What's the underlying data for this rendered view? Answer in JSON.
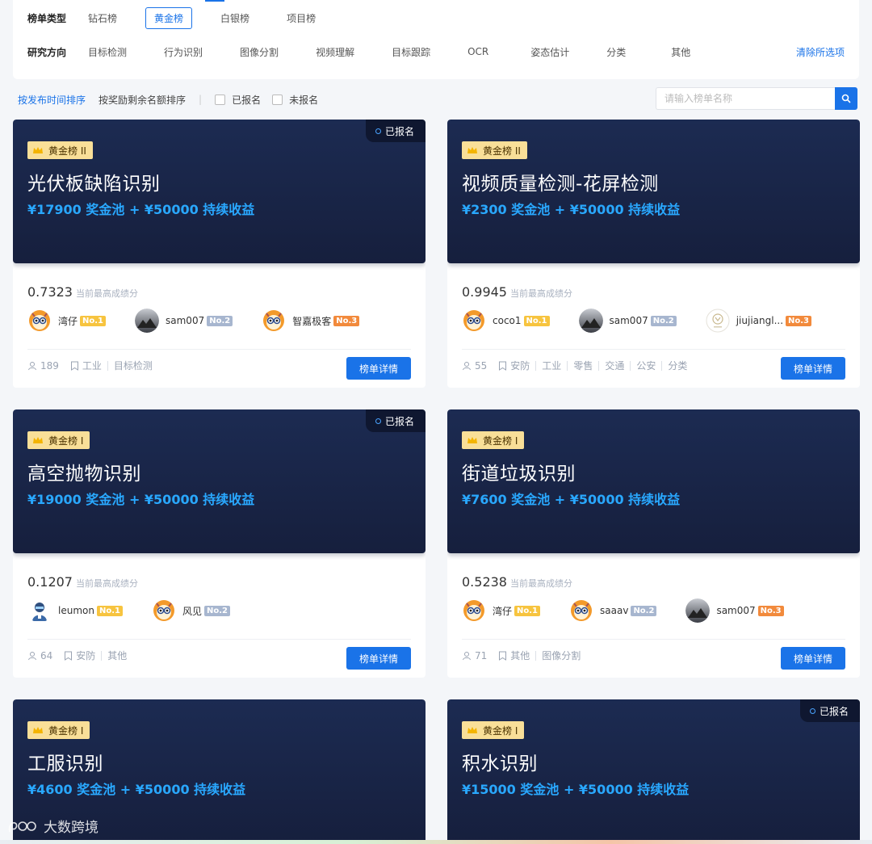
{
  "filters": {
    "type_label": "榜单类型",
    "types": [
      "钻石榜",
      "黄金榜",
      "白银榜",
      "项目榜"
    ],
    "active_type": "黄金榜",
    "direction_label": "研究方向",
    "directions": [
      "目标检测",
      "行为识别",
      "图像分割",
      "视频理解",
      "目标跟踪",
      "OCR",
      "姿态估计",
      "分类",
      "其他"
    ],
    "clear_label": "清除所选项"
  },
  "sort": {
    "by_time": "按发布时间排序",
    "by_remaining": "按奖励剩余名额排序",
    "separator": "|",
    "enrolled_label": "已报名",
    "not_enrolled_label": "未报名",
    "search_placeholder": "请输入榜单名称"
  },
  "common": {
    "score_label": "当前最高成绩分",
    "detail_button": "榜单详情",
    "enrolled_tag": "已报名"
  },
  "cards": [
    {
      "tier": "黄金榜 II",
      "title": "光伏板缺陷识别",
      "prize": "¥17900 奖金池 + ¥50000 持续收益",
      "enrolled": true,
      "score": "0.7323",
      "ranks": [
        {
          "name": "湾仔",
          "badge": "No.1",
          "avatar": "tiger"
        },
        {
          "name": "sam007",
          "badge": "No.2",
          "avatar": "photo"
        },
        {
          "name": "智嘉极客",
          "badge": "No.3",
          "avatar": "tiger"
        }
      ],
      "participants": "189",
      "tags": [
        "工业",
        "目标检测"
      ]
    },
    {
      "tier": "黄金榜 II",
      "title": "视频质量检测-花屏检测",
      "prize": "¥2300 奖金池 + ¥50000 持续收益",
      "enrolled": false,
      "score": "0.9945",
      "ranks": [
        {
          "name": "coco1",
          "badge": "No.1",
          "avatar": "tiger"
        },
        {
          "name": "sam007",
          "badge": "No.2",
          "avatar": "photo"
        },
        {
          "name": "jiujiangl...",
          "badge": "No.3",
          "avatar": "logo"
        }
      ],
      "participants": "55",
      "tags": [
        "安防",
        "工业",
        "零售",
        "交通",
        "公安",
        "分类"
      ]
    },
    {
      "tier": "黄金榜 I",
      "title": "高空抛物识别",
      "prize": "¥19000 奖金池 + ¥50000 持续收益",
      "enrolled": true,
      "score": "0.1207",
      "ranks": [
        {
          "name": "leumon",
          "badge": "No.1",
          "avatar": "person"
        },
        {
          "name": "风见",
          "badge": "No.2",
          "avatar": "tiger"
        }
      ],
      "participants": "64",
      "tags": [
        "安防",
        "其他"
      ]
    },
    {
      "tier": "黄金榜 I",
      "title": "街道垃圾识别",
      "prize": "¥7600 奖金池 + ¥50000 持续收益",
      "enrolled": false,
      "score": "0.5238",
      "ranks": [
        {
          "name": "湾仔",
          "badge": "No.1",
          "avatar": "tiger"
        },
        {
          "name": "saaav",
          "badge": "No.2",
          "avatar": "tiger"
        },
        {
          "name": "sam007",
          "badge": "No.3",
          "avatar": "photo"
        }
      ],
      "participants": "71",
      "tags": [
        "其他",
        "图像分割"
      ]
    },
    {
      "tier": "黄金榜 I",
      "title": "工服识别",
      "prize": "¥4600 奖金池 + ¥50000 持续收益",
      "enrolled": false
    },
    {
      "tier": "黄金榜 I",
      "title": "积水识别",
      "prize": "¥15000 奖金池 + ¥50000 持续收益",
      "enrolled": true
    }
  ],
  "watermark": "大数跨境",
  "colors": {
    "accent": "#1a73e8",
    "banner": "#1c2b52",
    "prize": "#29a8ff",
    "gold_badge": "#f9df98",
    "no1": "#f7c43f",
    "no2": "#a7b6cf",
    "no3": "#f28a3c"
  }
}
